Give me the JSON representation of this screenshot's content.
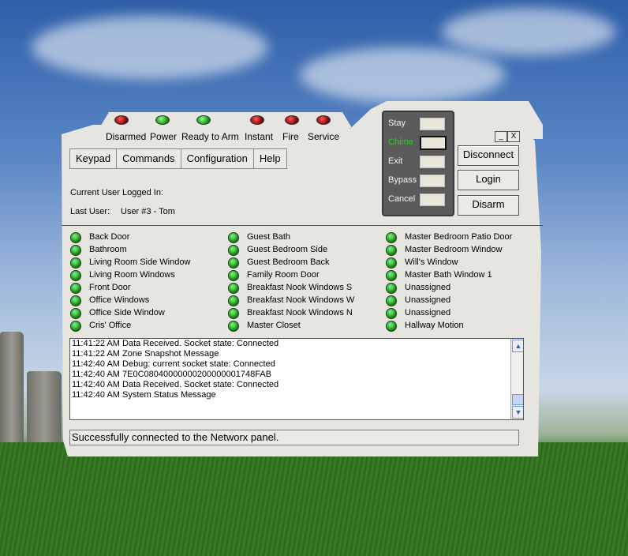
{
  "status_indicators": [
    {
      "label": "Disarmed",
      "led": "red"
    },
    {
      "label": "Power",
      "led": "green"
    },
    {
      "label": "Ready to Arm",
      "led": "green"
    },
    {
      "label": "Instant",
      "led": "red"
    },
    {
      "label": "Fire",
      "led": "red"
    },
    {
      "label": "Service",
      "led": "red"
    }
  ],
  "menu": [
    "Keypad",
    "Commands",
    "Configuration",
    "Help"
  ],
  "user_info": {
    "logged_in_label": "Current User Logged In:",
    "last_user_label": "Last User:",
    "last_user_value": "User #3 - Tom"
  },
  "arm_panel": [
    {
      "label": "Stay"
    },
    {
      "label": "Chime"
    },
    {
      "label": "Exit"
    },
    {
      "label": "Bypass"
    },
    {
      "label": "Cancel"
    }
  ],
  "buttons": [
    "Disconnect",
    "Login",
    "Disarm"
  ],
  "window_controls": {
    "minimize": "_",
    "close": "X"
  },
  "zones": {
    "col1": [
      "Back Door",
      "Bathroom",
      "Living Room Side Window",
      "Living Room Windows",
      "Front Door",
      "Office Windows",
      "Office Side Window",
      "Cris' Office"
    ],
    "col2": [
      "Guest Bath",
      "Guest Bedroom Side",
      "Guest Bedroom Back",
      "Family Room Door",
      "Breakfast Nook Windows S",
      "Breakfast Nook Windows W",
      "Breakfast Nook Windows N",
      "Master Closet"
    ],
    "col3": [
      "Master Bedroom Patio Door",
      "Master Bedroom Window",
      "Will's Window",
      "Master Bath Window 1",
      "Unassigned",
      "Unassigned",
      "Unassigned",
      "Hallway Motion"
    ]
  },
  "log": [
    "11:41:22 AM Data Received.  Socket state: Connected",
    "11:41:22 AM Zone Snapshot Message",
    "11:42:40 AM Debug: current socket state: Connected",
    "11:42:40 AM 7E0C08040000000200000001748FAB",
    "11:42:40 AM Data Received.  Socket state: Connected",
    "11:42:40 AM System Status Message"
  ],
  "status_message": "Successfully connected to the Networx panel.",
  "colors": {
    "led_red": "#c00000",
    "led_green": "#1a9a1a",
    "chime_highlight": "#1ed61e",
    "panel_bg": "#e7e5e0"
  }
}
